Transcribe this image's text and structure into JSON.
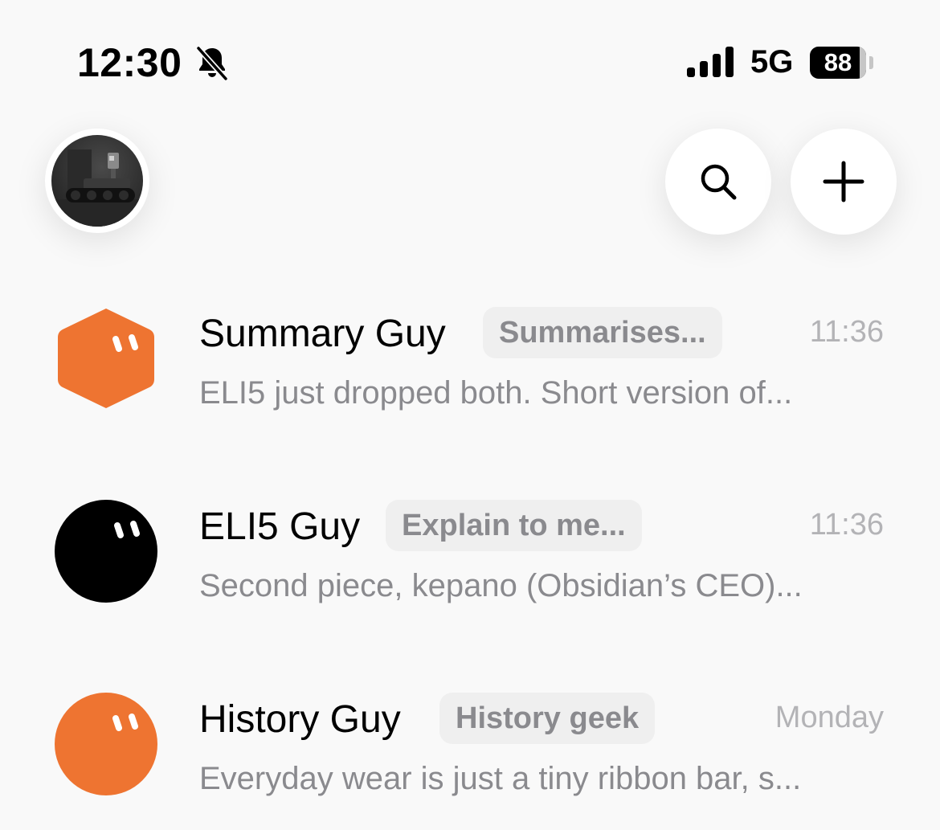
{
  "status_bar": {
    "time": "12:30",
    "network": "5G",
    "battery": "88",
    "icons": [
      "bell-off-icon",
      "cellular-signal-icon",
      "battery-icon"
    ]
  },
  "header": {
    "avatar_icon": "profile-avatar-robot",
    "search_icon": "search-icon",
    "add_icon": "plus-icon"
  },
  "chats": [
    {
      "name": "Summary Guy",
      "tag": "Summarises...",
      "time": "11:36",
      "preview": "ELI5 just dropped both. Short version of...",
      "icon": "hexagon-face-icon",
      "color": "#ee7431"
    },
    {
      "name": "ELI5 Guy",
      "tag": "Explain to me...",
      "time": "11:36",
      "preview": "Second piece, kepano (Obsidian’s CEO)...",
      "icon": "circle-face-icon",
      "color": "#000000"
    },
    {
      "name": "History Guy",
      "tag": "History geek",
      "time": "Monday",
      "preview": "Everyday wear is just a tiny ribbon bar, s...",
      "icon": "circle-face-icon",
      "color": "#ee7431"
    }
  ],
  "colors": {
    "background": "#f9f9f9",
    "accent_orange": "#ee7431",
    "secondary_text": "#8a8a8e",
    "tag_background": "#efefef"
  }
}
